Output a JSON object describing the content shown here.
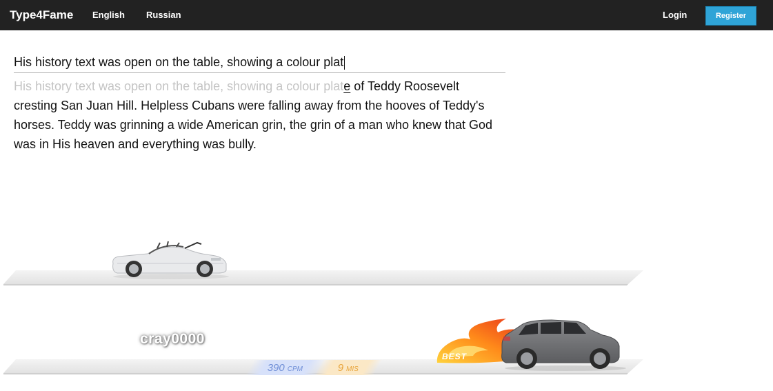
{
  "navbar": {
    "brand": "Type4Fame",
    "links": [
      "English",
      "Russian"
    ],
    "login": "Login",
    "register": "Register"
  },
  "typing": {
    "input_value": "His history text was open on the table, showing a colour plat",
    "typed_text": "His history text was open on the table, showing a colour plat",
    "current_char": "e",
    "remaining_text": " of Teddy Roosevelt cresting San Juan Hill. Helpless Cubans were falling away from the hooves of Teddy's horses. Teddy was grinning a wide American grin, the grin of a man who knew that God was in His heaven and everything was bully."
  },
  "race": {
    "player": {
      "name": "cray0000",
      "cpm": "390",
      "cpm_unit": "CPM",
      "mistakes": "9",
      "mistakes_unit": "MIS"
    },
    "best_label": "BEST"
  },
  "colors": {
    "navbar_bg": "#222222",
    "register_bg": "#2fa4d7",
    "typed_text": "#c4c4c4",
    "cpm": "#6f8ed6",
    "mistakes": "#e8a43a"
  }
}
